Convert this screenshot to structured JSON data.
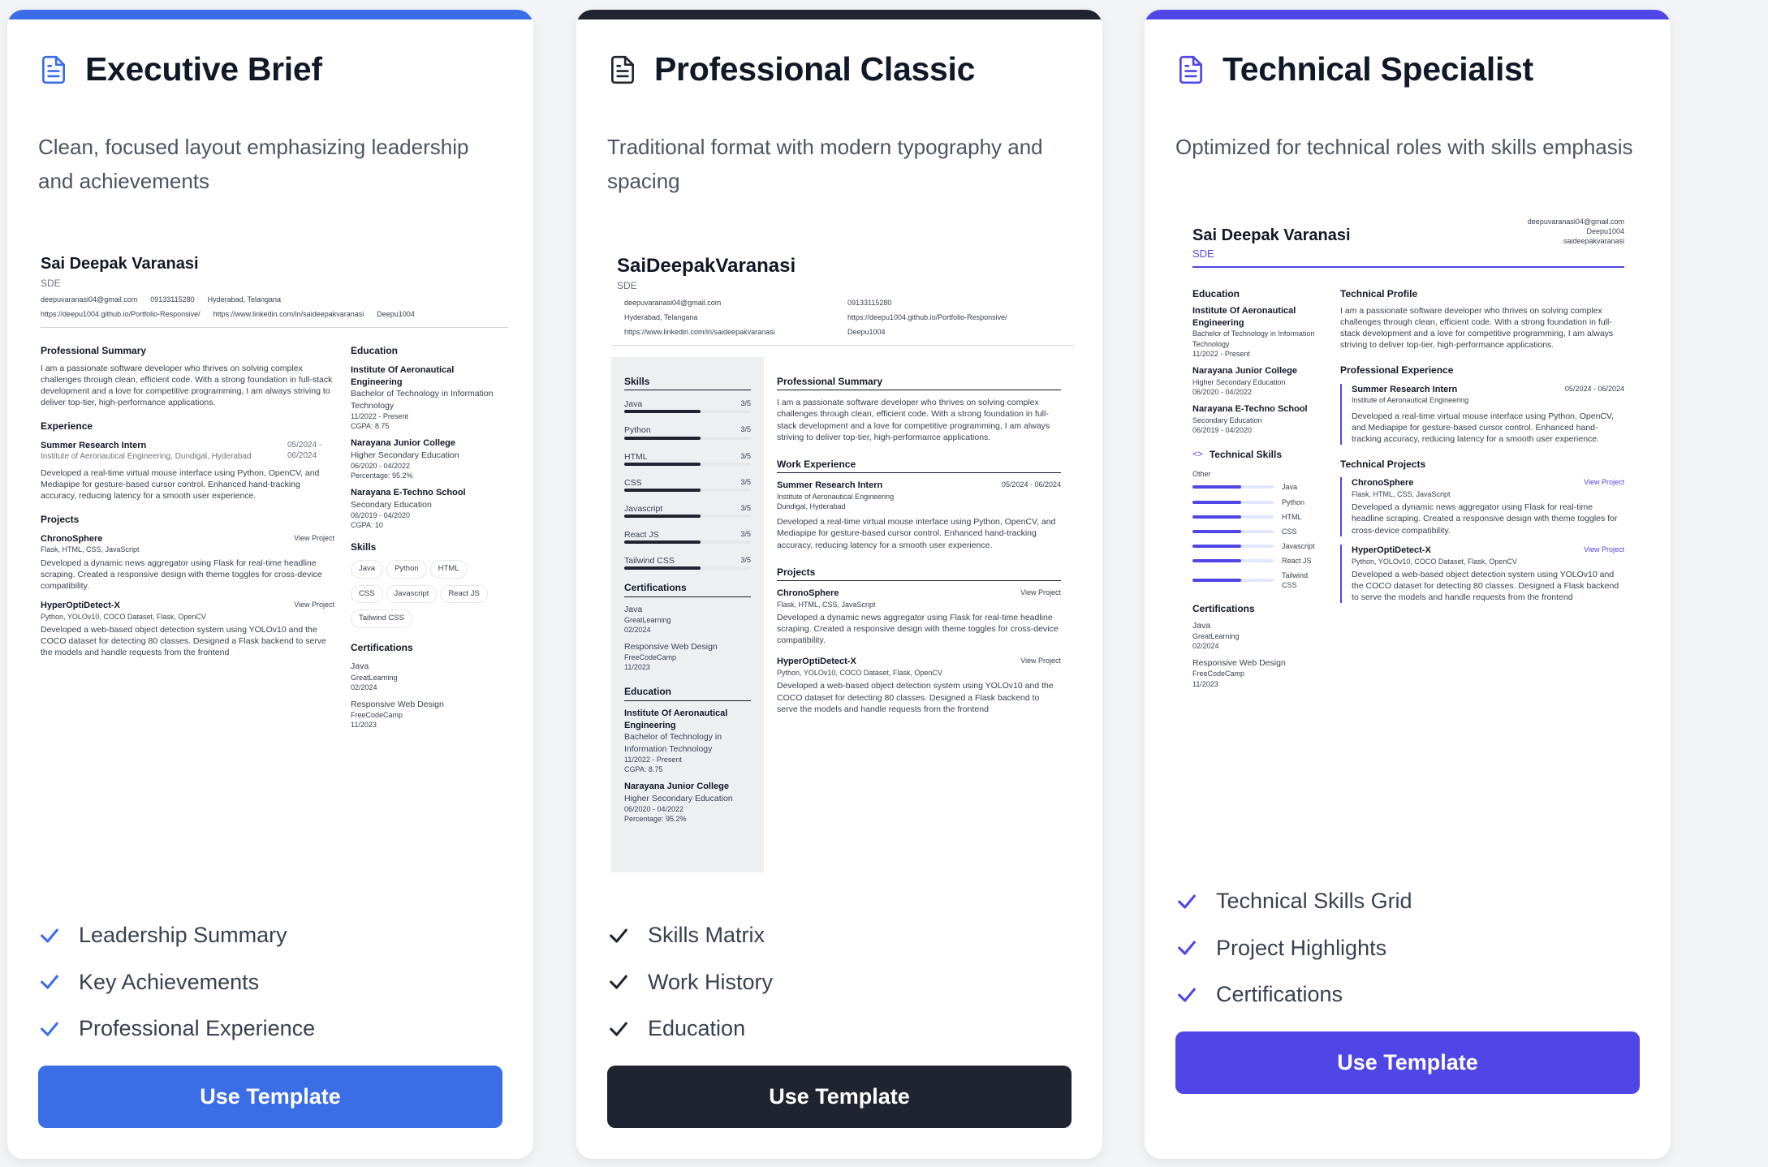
{
  "colors": {
    "blue": "#3b6ee6",
    "dark": "#1f2430",
    "indigo": "#4f46e5"
  },
  "cards": [
    {
      "title": "Executive Brief",
      "description": "Clean, focused layout emphasizing leadership and achievements",
      "features": [
        "Leadership Summary",
        "Key Achievements",
        "Professional Experience"
      ],
      "button": "Use Template"
    },
    {
      "title": "Professional Classic",
      "description": "Traditional format with modern typography and spacing",
      "features": [
        "Skills Matrix",
        "Work History",
        "Education"
      ],
      "button": "Use Template"
    },
    {
      "title": "Technical Specialist",
      "description": "Optimized for technical roles with skills emphasis",
      "features": [
        "Technical Skills Grid",
        "Project Highlights",
        "Certifications"
      ],
      "button": "Use Template"
    }
  ],
  "resume": {
    "name": "Sai Deepak Varanasi",
    "name_tight": "SaiDeepakVaranasi",
    "role": "SDE",
    "email": "deepuvaranasi04@gmail.com",
    "phone": "09133115280",
    "location": "Hyderabad, Telangana",
    "portfolio": "https://deepu1004.github.io/Portfolio-Responsive/",
    "linkedin": "https://www.linkedin.com/in/saideepakvaranasi",
    "github": "Deepu1004",
    "linkedin_short": "saideepakvaranasi",
    "summary_heading": "Professional Summary",
    "tech_profile_heading": "Technical Profile",
    "summary": "I am a passionate software developer who thrives on solving complex challenges through clean, efficient code. With a strong foundation in full-stack development and a love for competitive programming, I am always striving to deliver top-tier, high-performance applications.",
    "experience_heading": "Experience",
    "work_heading": "Work Experience",
    "pro_exp_heading": "Professional Experience",
    "job": {
      "title": "Summer Research Intern",
      "company": "Institute of Aeronautical Engineering",
      "company_loc": "Institute of Aeronautical Engineering, Dundigal, Hyderabad",
      "location": "Dundigal, Hyderabad",
      "dates": "05/2024 - 06/2024",
      "description": "Developed a real-time virtual mouse interface using Python, OpenCV, and Mediapipe for gesture-based cursor control. Enhanced hand-tracking accuracy, reducing latency for a smooth user experience."
    },
    "projects_heading": "Projects",
    "tech_projects_heading": "Technical Projects",
    "view_project": "View Project",
    "projects": [
      {
        "name": "ChronoSphere",
        "tech": "Flask, HTML, CSS, JavaScript",
        "description": "Developed a dynamic news aggregator using Flask for real-time headline scraping. Created a responsive design with theme toggles for cross-device compatibility."
      },
      {
        "name": "HyperOptiDetect-X",
        "tech": "Python, YOLOv10, COCO Dataset, Flask, OpenCV",
        "description": "Developed a web-based object detection system using YOLOv10 and the COCO dataset for detecting 80 classes. Designed a Flask backend to serve the models and handle requests from the frontend"
      }
    ],
    "education_heading": "Education",
    "education": [
      {
        "school": "Institute Of Aeronautical Engineering",
        "degree": "Bachelor of Technology in Information Technology",
        "dates": "11/2022 - Present",
        "score": "CGPA: 8.75"
      },
      {
        "school": "Narayana Junior College",
        "degree": "Higher Secondary Education",
        "dates": "06/2020 - 04/2022",
        "score": "Percentage: 95.2%"
      },
      {
        "school": "Narayana E-Techno School",
        "degree": "Secondary Education",
        "dates": "06/2019 - 04/2020",
        "score": "CGPA: 10"
      }
    ],
    "skills_heading": "Skills",
    "tech_skills_heading": "Technical Skills",
    "skills_group": "Other",
    "skills": [
      "Java",
      "Python",
      "HTML",
      "CSS",
      "Javascript",
      "React JS",
      "Tailwind CSS"
    ],
    "skill_rating": "3/5",
    "skill_level": 0.6,
    "certifications_heading": "Certifications",
    "certifications": [
      {
        "name": "Java",
        "issuer": "GreatLearning",
        "date": "02/2024"
      },
      {
        "name": "Responsive Web Design",
        "issuer": "FreeCodeCamp",
        "date": "11/2023"
      }
    ]
  }
}
